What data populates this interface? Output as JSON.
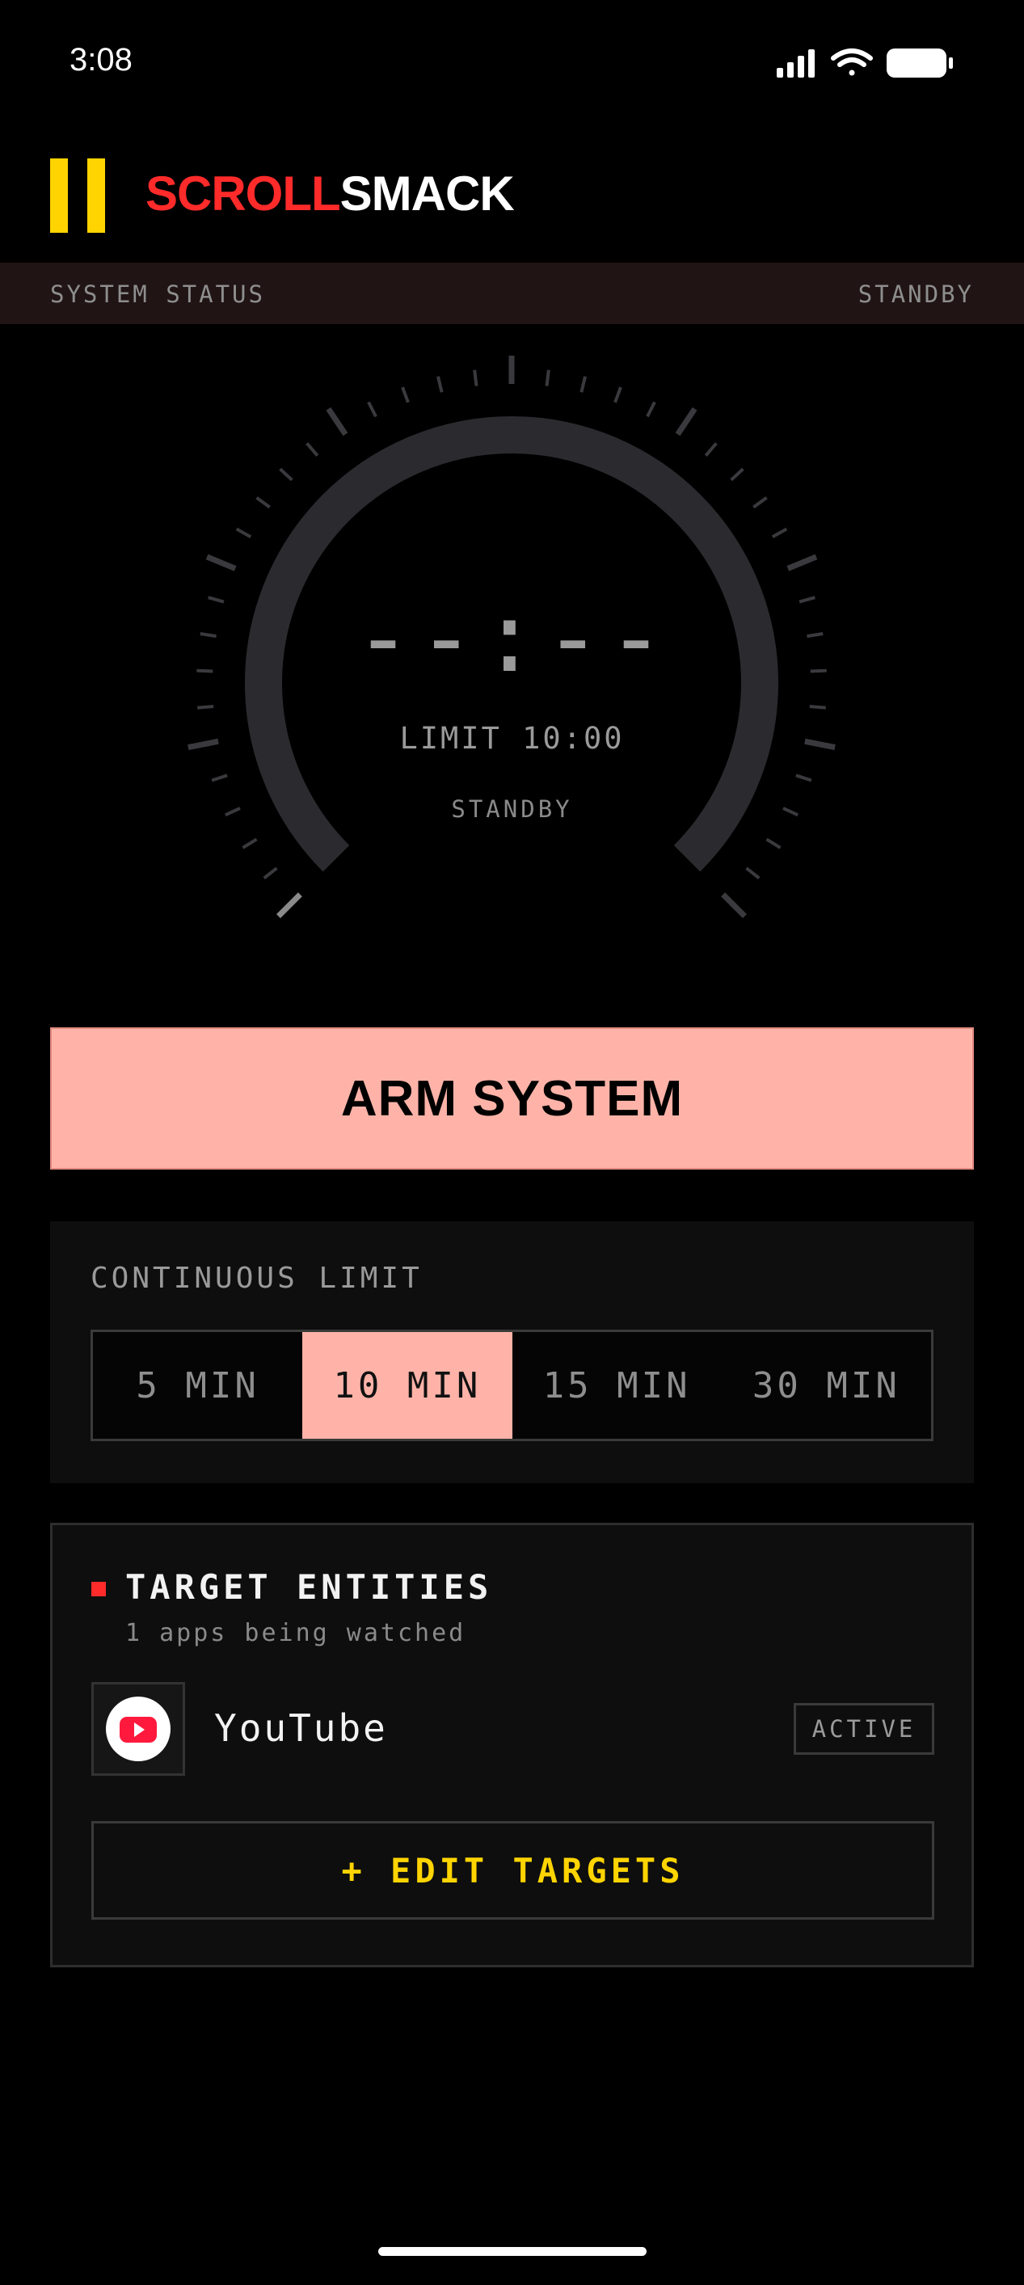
{
  "status_bar": {
    "time": "3:08"
  },
  "header": {
    "brand_part1": "SCROLL",
    "brand_part2": "SMACK"
  },
  "system_status": {
    "label": "SYSTEM STATUS",
    "value": "STANDBY"
  },
  "gauge": {
    "time": "--:--",
    "limit": "LIMIT 10:00",
    "state": "STANDBY",
    "progress": 0
  },
  "arm_button": {
    "label": "ARM SYSTEM"
  },
  "continuous_limit": {
    "title": "CONTINUOUS LIMIT",
    "options": [
      "5 MIN",
      "10 MIN",
      "15 MIN",
      "30 MIN"
    ],
    "selected": "10 MIN"
  },
  "targets": {
    "title": "TARGET ENTITIES",
    "subtitle": "1 apps being watched",
    "apps": [
      {
        "name": "YouTube",
        "status": "ACTIVE",
        "icon": "youtube-icon"
      }
    ],
    "edit_label": "+ EDIT TARGETS"
  },
  "colors": {
    "accent_red": "#ff2b2b",
    "accent_yellow": "#ffd400",
    "salmon": "#ffb3a8",
    "background": "#000000"
  }
}
